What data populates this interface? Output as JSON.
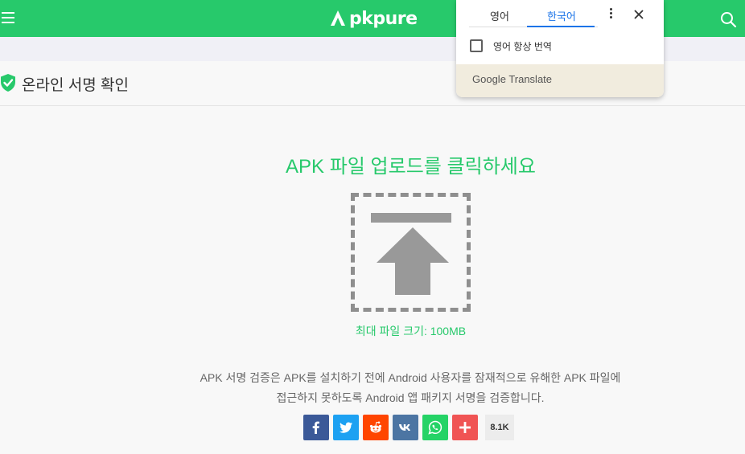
{
  "header": {
    "logo_text": "pkpure",
    "brand_color": "#27c96b"
  },
  "page": {
    "title": "온라인 서명 확인",
    "upload_title": "APK 파일 업로드를 클릭하세요",
    "max_size": "최대 파일 크기: 100MB",
    "description_line1": "APK 서명 검증은 APK를 설치하기 전에 Android 사용자를 잠재적으로 유해한 APK 파일에",
    "description_line2": "접근하지 못하도록 Android 앱 패키지 서명을 검증합니다."
  },
  "share": {
    "count": "8.1K",
    "buttons": [
      {
        "name": "facebook",
        "color": "#3b5998"
      },
      {
        "name": "twitter",
        "color": "#1da1f2"
      },
      {
        "name": "reddit",
        "color": "#ff4500"
      },
      {
        "name": "vk",
        "color": "#4c75a3"
      },
      {
        "name": "whatsapp",
        "color": "#25d366"
      },
      {
        "name": "more",
        "color": "#f05454"
      }
    ]
  },
  "translate_popup": {
    "tab_source": "영어",
    "tab_target": "한국어",
    "always_translate_label": "영어 항상 번역",
    "brand_google": "Google",
    "brand_translate": "Translate"
  }
}
